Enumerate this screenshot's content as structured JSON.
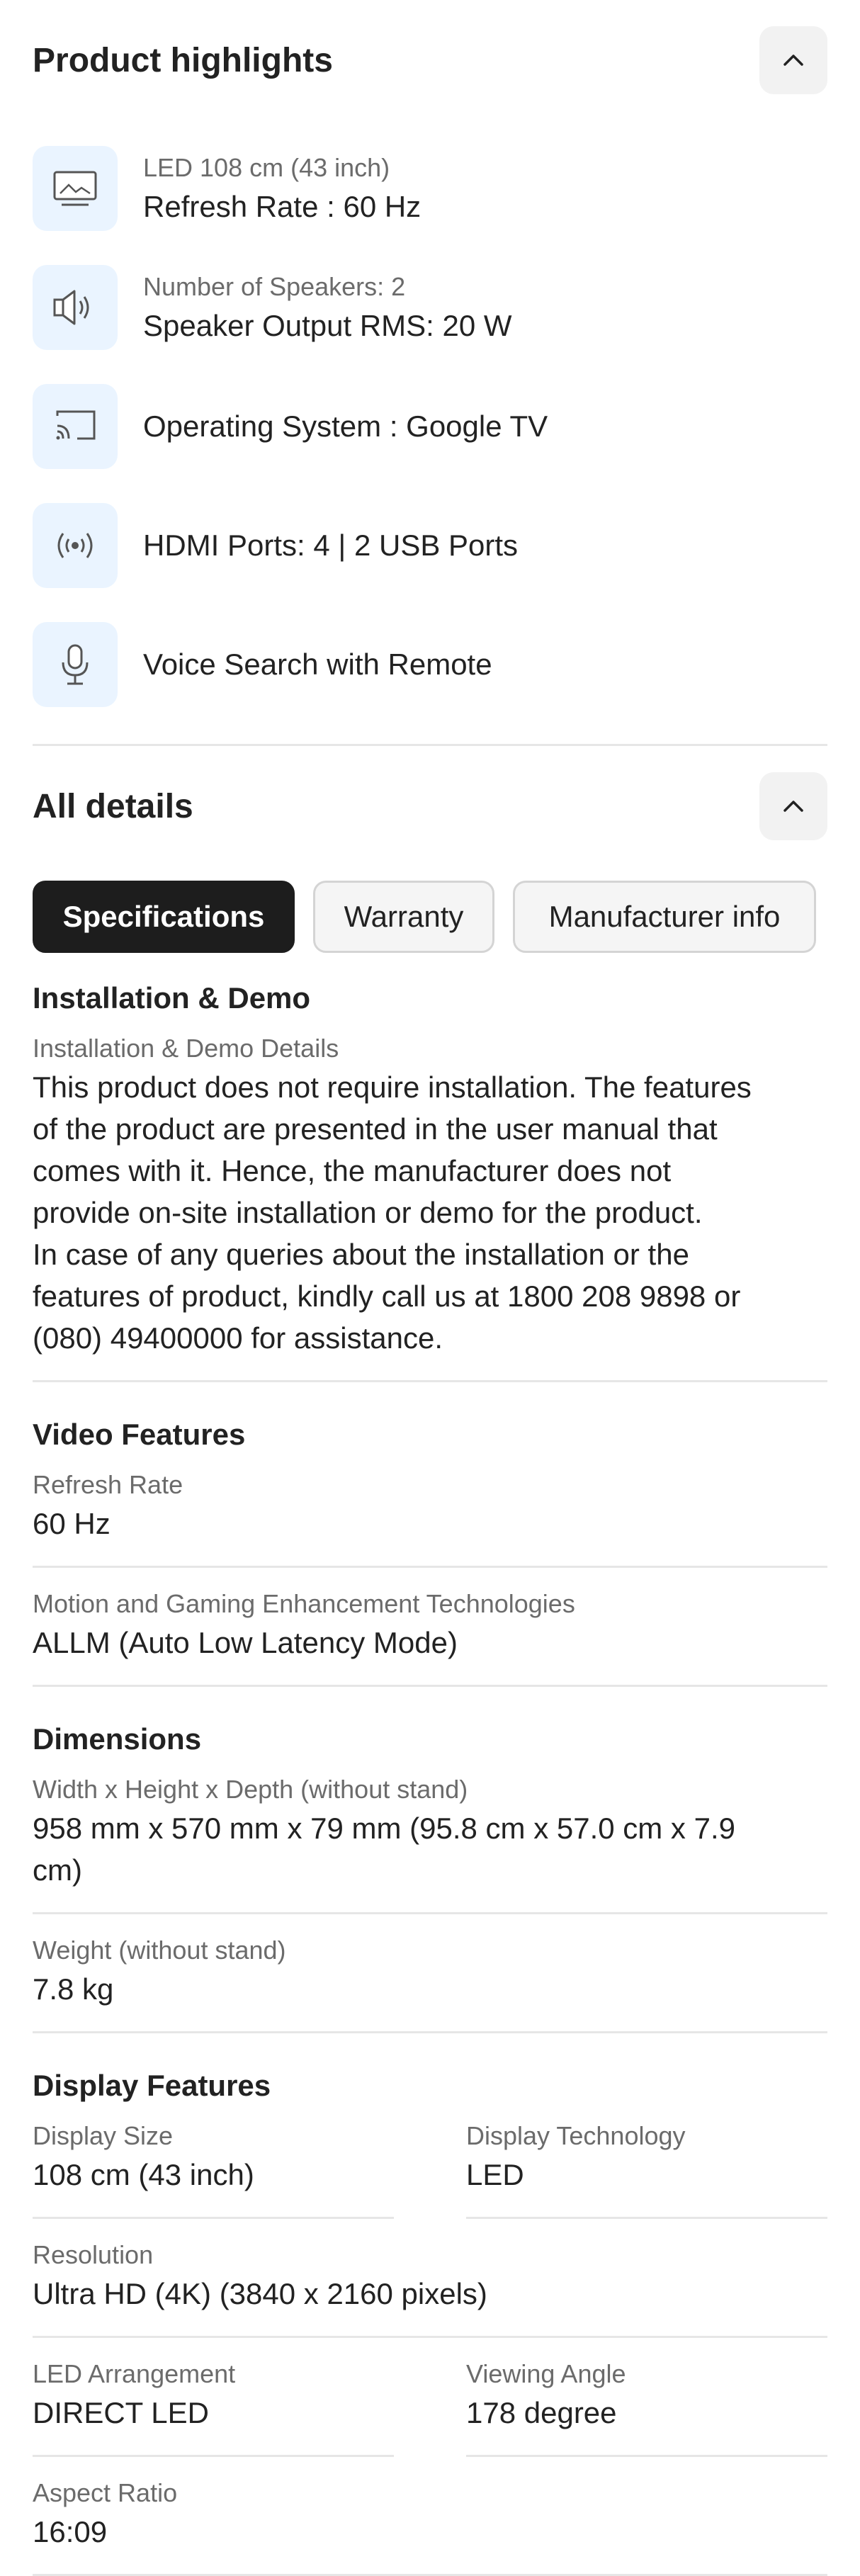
{
  "highlights": {
    "title": "Product highlights",
    "items": [
      {
        "icon": "tv-screen-icon",
        "sub": "LED 108 cm (43 inch)",
        "main": "Refresh Rate : 60 Hz"
      },
      {
        "icon": "speaker-icon",
        "sub": "Number of Speakers: 2",
        "main": "Speaker Output RMS: 20 W"
      },
      {
        "icon": "cast-screen-icon",
        "sub": "",
        "main": "Operating System : Google TV"
      },
      {
        "icon": "broadcast-icon",
        "sub": "",
        "main": "HDMI Ports: 4 | 2 USB Ports"
      },
      {
        "icon": "microphone-icon",
        "sub": "",
        "main": "Voice Search with Remote"
      }
    ]
  },
  "details": {
    "title": "All details",
    "tabs": [
      "Specifications",
      "Warranty",
      "Manufacturer info"
    ],
    "installation": {
      "title": "Installation & Demo",
      "label": "Installation & Demo Details",
      "value_lines": [
        "This product does not require installation. The features",
        "of the product are presented in the user manual that",
        "comes with it. Hence, the manufacturer does not",
        "provide on-site installation or demo for the product.",
        "In case of any queries about the installation or the",
        "features of product, kindly call us at 1800 208 9898 or",
        "(080) 49400000 for assistance."
      ]
    },
    "video": {
      "title": "Video Features",
      "fields": [
        {
          "label": "Refresh Rate",
          "value": "60 Hz"
        },
        {
          "label": "Motion and Gaming Enhancement Technologies",
          "value": "ALLM (Auto Low Latency Mode)"
        }
      ]
    },
    "dimensions": {
      "title": "Dimensions",
      "fields": [
        {
          "label": "Width x Height x Depth (without stand)",
          "value_lines": [
            "958 mm x 570 mm x 79 mm (95.8 cm x 57.0 cm x 7.9",
            "cm)"
          ]
        },
        {
          "label": "Weight (without stand)",
          "value": "7.8 kg"
        }
      ]
    },
    "display": {
      "title": "Display Features",
      "display_size": {
        "label": "Display Size",
        "value": "108 cm (43 inch)"
      },
      "display_tech": {
        "label": "Display Technology",
        "value": "LED"
      },
      "resolution": {
        "label": "Resolution",
        "value": "Ultra HD (4K) (3840 x 2160 pixels)"
      },
      "led_arrangement": {
        "label": "LED Arrangement",
        "value": "DIRECT LED"
      },
      "viewing_angle": {
        "label": "Viewing Angle",
        "value": "178 degree"
      },
      "aspect_ratio": {
        "label": "Aspect Ratio",
        "value": "16:09"
      }
    }
  }
}
